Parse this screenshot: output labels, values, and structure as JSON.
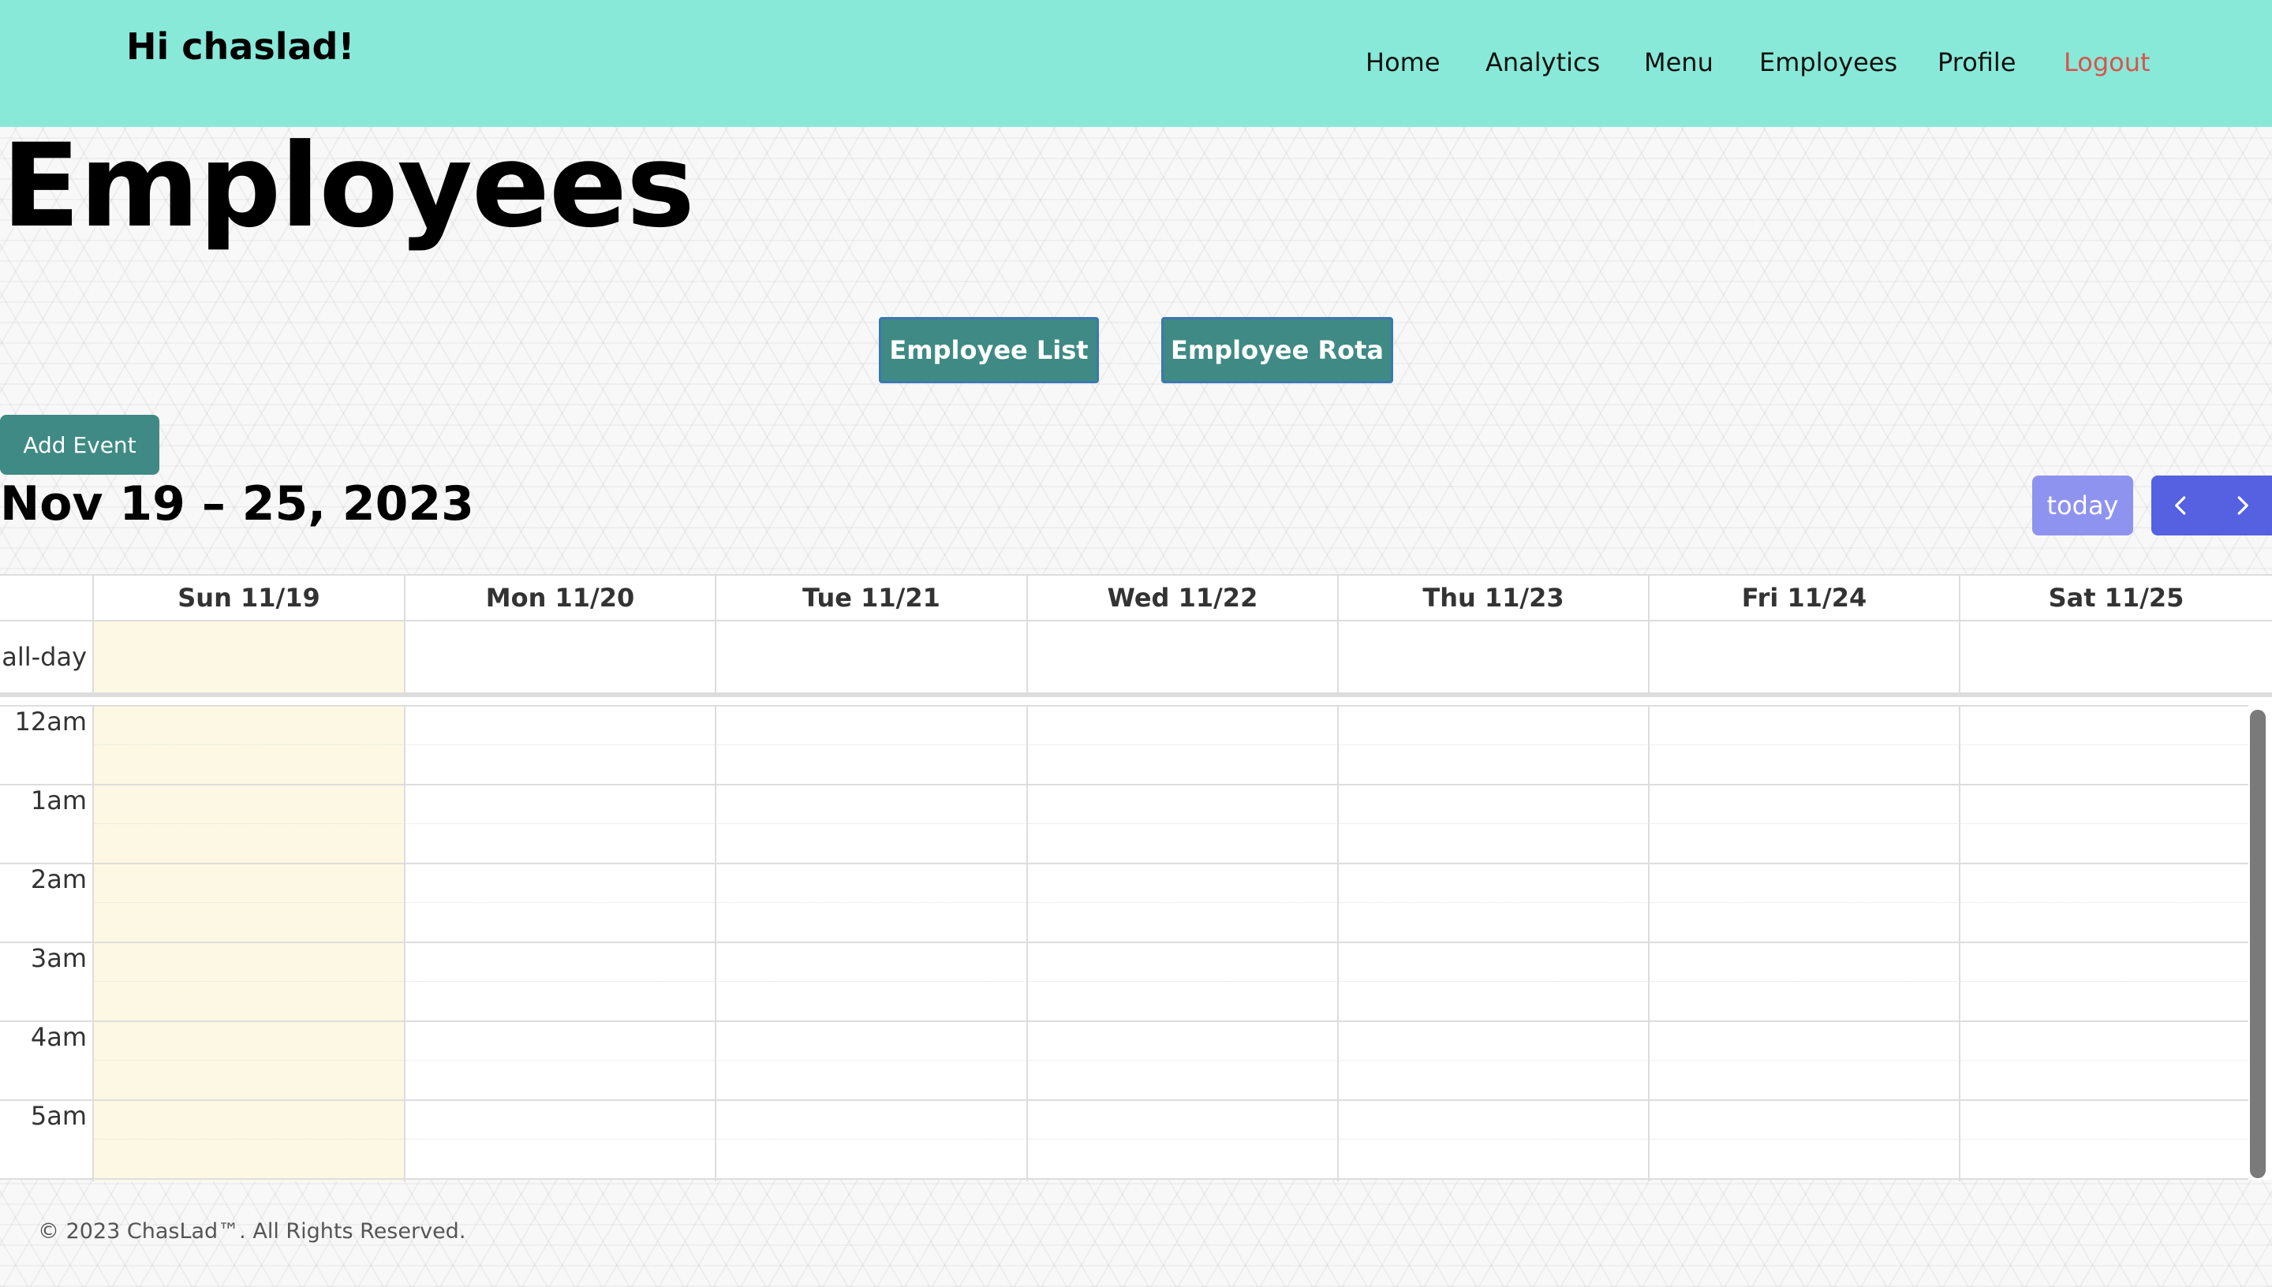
{
  "navbar": {
    "greeting": "Hi chaslad!",
    "links": [
      "Home",
      "Analytics",
      "Menu",
      "Employees",
      "Profile",
      "Logout"
    ],
    "logout_color": "#d9534f",
    "background": "#88e9d8"
  },
  "page": {
    "title": "Employees",
    "buttons": {
      "employee_list": "Employee List",
      "employee_rota": "Employee Rota"
    }
  },
  "calendar": {
    "add_event": "Add Event",
    "date_range": "Nov 19 – 25, 2023",
    "today": "today",
    "prev_icon": "chevron-left-icon",
    "next_icon": "chevron-right-icon",
    "days": [
      "Sun 11/19",
      "Mon 11/20",
      "Tue 11/21",
      "Wed 11/22",
      "Thu 11/23",
      "Fri 11/24",
      "Sat 11/25"
    ],
    "highlighted_day": "Sun 11/19",
    "all_day_label": "all-day",
    "time_labels": [
      "12am",
      "1am",
      "2am",
      "3am",
      "4am",
      "5am"
    ],
    "accent_color": "#5561e0",
    "today_bg": "#fcf8e3"
  },
  "footer": {
    "text": "© 2023 ChasLad™. All Rights Reserved."
  }
}
